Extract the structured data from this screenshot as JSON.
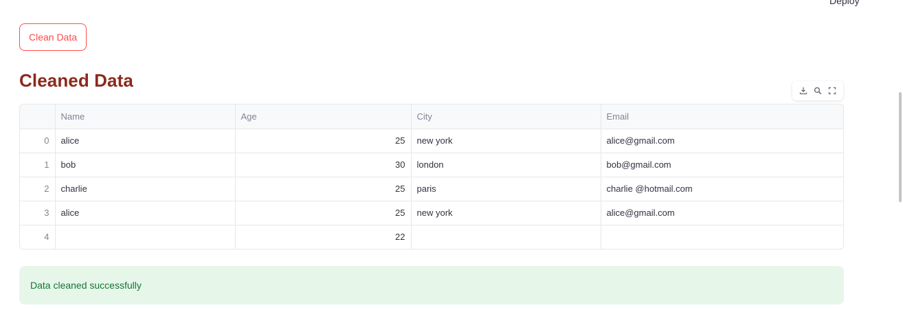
{
  "header": {
    "deploy_label": "Deploy",
    "menu_icon": "kebab-menu-icon"
  },
  "actions": {
    "clean_button_label": "Clean Data"
  },
  "section": {
    "title": "Cleaned Data"
  },
  "toolbar": {
    "icons": [
      "download-icon",
      "search-icon",
      "fullscreen-icon"
    ]
  },
  "table": {
    "columns": [
      "",
      "Name",
      "Age",
      "City",
      "Email"
    ],
    "rows": [
      {
        "index": "0",
        "name": "alice",
        "age": "25",
        "city": "new york",
        "email": "alice@gmail.com"
      },
      {
        "index": "1",
        "name": "bob",
        "age": "30",
        "city": "london",
        "email": "bob@gmail.com"
      },
      {
        "index": "2",
        "name": "charlie",
        "age": "25",
        "city": "paris",
        "email": "charlie @hotmail.com"
      },
      {
        "index": "3",
        "name": "alice",
        "age": "25",
        "city": "new york",
        "email": "alice@gmail.com"
      },
      {
        "index": "4",
        "name": "",
        "age": "22",
        "city": "",
        "email": ""
      }
    ]
  },
  "alert": {
    "message": "Data cleaned successfully"
  },
  "colors": {
    "accent": "#ff4b4b",
    "title": "#8b2a1c",
    "success_bg": "#e6f7ea",
    "success_text": "#177233"
  }
}
